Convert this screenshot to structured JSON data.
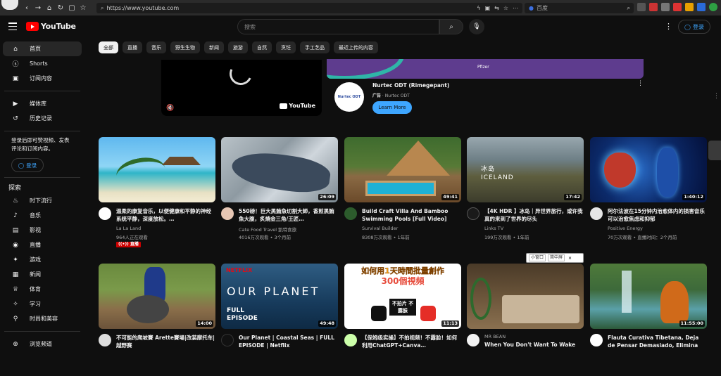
{
  "browser": {
    "url": "https://www.youtube.com",
    "search_placeholder": "百度",
    "nav_icons": [
      "back-icon",
      "forward-icon",
      "home-icon",
      "reload-icon",
      "page-icon",
      "star-icon"
    ]
  },
  "header": {
    "logo_text": "YouTube",
    "search_placeholder": "搜索",
    "login_label": "登录"
  },
  "sidebar": {
    "items": [
      {
        "label": "首页",
        "icon": "home-icon",
        "glyph": "⌂"
      },
      {
        "label": "Shorts",
        "icon": "shorts-icon",
        "glyph": "ⓢ"
      },
      {
        "label": "订阅内容",
        "icon": "subscriptions-icon",
        "glyph": "▣"
      }
    ],
    "items2": [
      {
        "label": "媒体库",
        "icon": "library-icon",
        "glyph": "▶"
      },
      {
        "label": "历史记录",
        "icon": "history-icon",
        "glyph": "↺"
      }
    ],
    "login_prompt": "登录后即可赞视频、发表评论和订阅内容。",
    "login_label": "登录",
    "explore_heading": "探索",
    "explore": [
      {
        "label": "时下流行",
        "icon": "trending-icon",
        "glyph": "♨"
      },
      {
        "label": "音乐",
        "icon": "music-icon",
        "glyph": "♪"
      },
      {
        "label": "影视",
        "icon": "movies-icon",
        "glyph": "▤"
      },
      {
        "label": "直播",
        "icon": "live-icon",
        "glyph": "◉"
      },
      {
        "label": "游戏",
        "icon": "gaming-icon",
        "glyph": "✦"
      },
      {
        "label": "新闻",
        "icon": "news-icon",
        "glyph": "▦"
      },
      {
        "label": "体育",
        "icon": "sports-icon",
        "glyph": "♕"
      },
      {
        "label": "学习",
        "icon": "learning-icon",
        "glyph": "✧"
      },
      {
        "label": "时尚和美容",
        "icon": "fashion-icon",
        "glyph": "⚲"
      }
    ],
    "browse_channels": "浏览频道"
  },
  "chips": [
    "全部",
    "直播",
    "音乐",
    "野生生物",
    "新闻",
    "旅游",
    "自然",
    "烹饪",
    "手工艺品",
    "最近上传的内容"
  ],
  "ad": {
    "title": "Nurtec ODT (Rimegepant)",
    "ad_label": "广告",
    "advertiser": "Nurtec ODT",
    "cta": "Learn More",
    "logo_text": "Nurtec ODT",
    "banner_brand": "Pfizer",
    "player_brand": "YouTube"
  },
  "videos_row1": [
    {
      "title": "温柔的康复音乐，以便健康和平静的神经系统平静，深度放松。…",
      "channel": "La La Land",
      "stats": "964人正在观看",
      "live_badge": "直播",
      "duration": ""
    },
    {
      "title": "550磅！巨大黑鮪魚切割大師，香煎黑鮪魚大腹，炙燒金三角/王匠…",
      "channel": "Cate Food Travel 凱特食旅",
      "stats": "4016万次观看 • 3个月前",
      "duration": "26:09"
    },
    {
      "title": "Build Craft Villa And Bamboo Swimming Pools [Full Video]",
      "channel": "Survival Builder",
      "stats": "8308万次观看 • 1年前",
      "duration": "49:41"
    },
    {
      "title": "【4K HDR 】冰岛｜异世界旅行，或许我真的来到了世界的尽头",
      "channel": "Links TV",
      "stats": "199万次观看 • 1年前",
      "duration": "17:42",
      "thumb_text": "冰岛 ICELAND"
    },
    {
      "title": "阿尔法波在15分钟内治愈体内的损害音乐可以治愈焦虑和抑郁",
      "channel": "Positive Energy",
      "stats": "70万次观看 • 直播时间：2个月前",
      "duration": "1:40:12"
    }
  ],
  "videos_row2": [
    {
      "title": "不可能的爬坡賽 Arette賽場|改装摩托车|越野赛",
      "duration": "14:00"
    },
    {
      "title": "Our Planet | Coastal Seas | FULL EPISODE | Netflix",
      "duration": "49:48",
      "thumb_brand": "NETFLIX",
      "thumb_big": "OUR PLANET",
      "thumb_small": "FULL EPISODE"
    },
    {
      "title": "【保姆级实操】不拍视频！不露脸！如何利用ChatGPT+Canva…",
      "duration": "11:13",
      "thumb_big": "如何用1天時間批量創作",
      "thumb_small": "300個視頻",
      "thumb_tag": "不拍片 不露臉"
    },
    {
      "title": "When You Don't Want To Wake",
      "channel": "MR BEAN",
      "duration": ""
    },
    {
      "title": "Flauta Curativa Tibetana, Deja de Pensar Demasiado, Elimina el…",
      "duration": "11:55:00"
    }
  ],
  "mini_player": {
    "a": "小窗口",
    "b": "简中屏"
  }
}
